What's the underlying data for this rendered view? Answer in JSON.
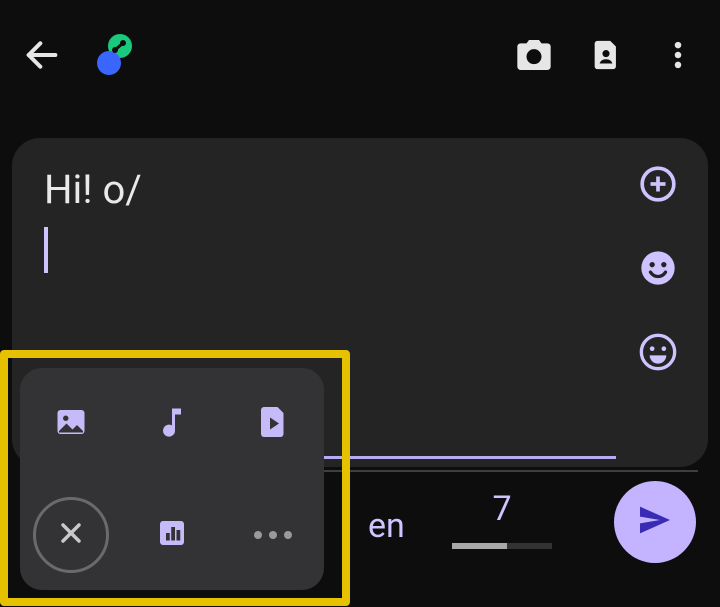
{
  "compose": {
    "text": "Hi! o/"
  },
  "toolbar": {
    "language": "en",
    "char_count": "7"
  },
  "icons": {
    "back": "back-icon",
    "logo": "app-logo-icon",
    "camera": "camera-icon",
    "contact": "contact-card-icon",
    "overflow": "overflow-menu-icon",
    "add": "add-circle-icon",
    "emoji_smile": "emoji-smile-icon",
    "emoji_grin": "emoji-grin-icon",
    "send": "send-icon",
    "attach_image": "image-icon",
    "attach_audio": "music-note-icon",
    "attach_video": "video-file-icon",
    "close": "close-icon",
    "poll": "poll-icon",
    "more": "more-horizontal-icon"
  },
  "colors": {
    "accent": "#c6baf9",
    "send_bg": "#c4b4ff",
    "highlight_border": "#e5c100",
    "panel": "#242424",
    "popup": "#333235"
  }
}
